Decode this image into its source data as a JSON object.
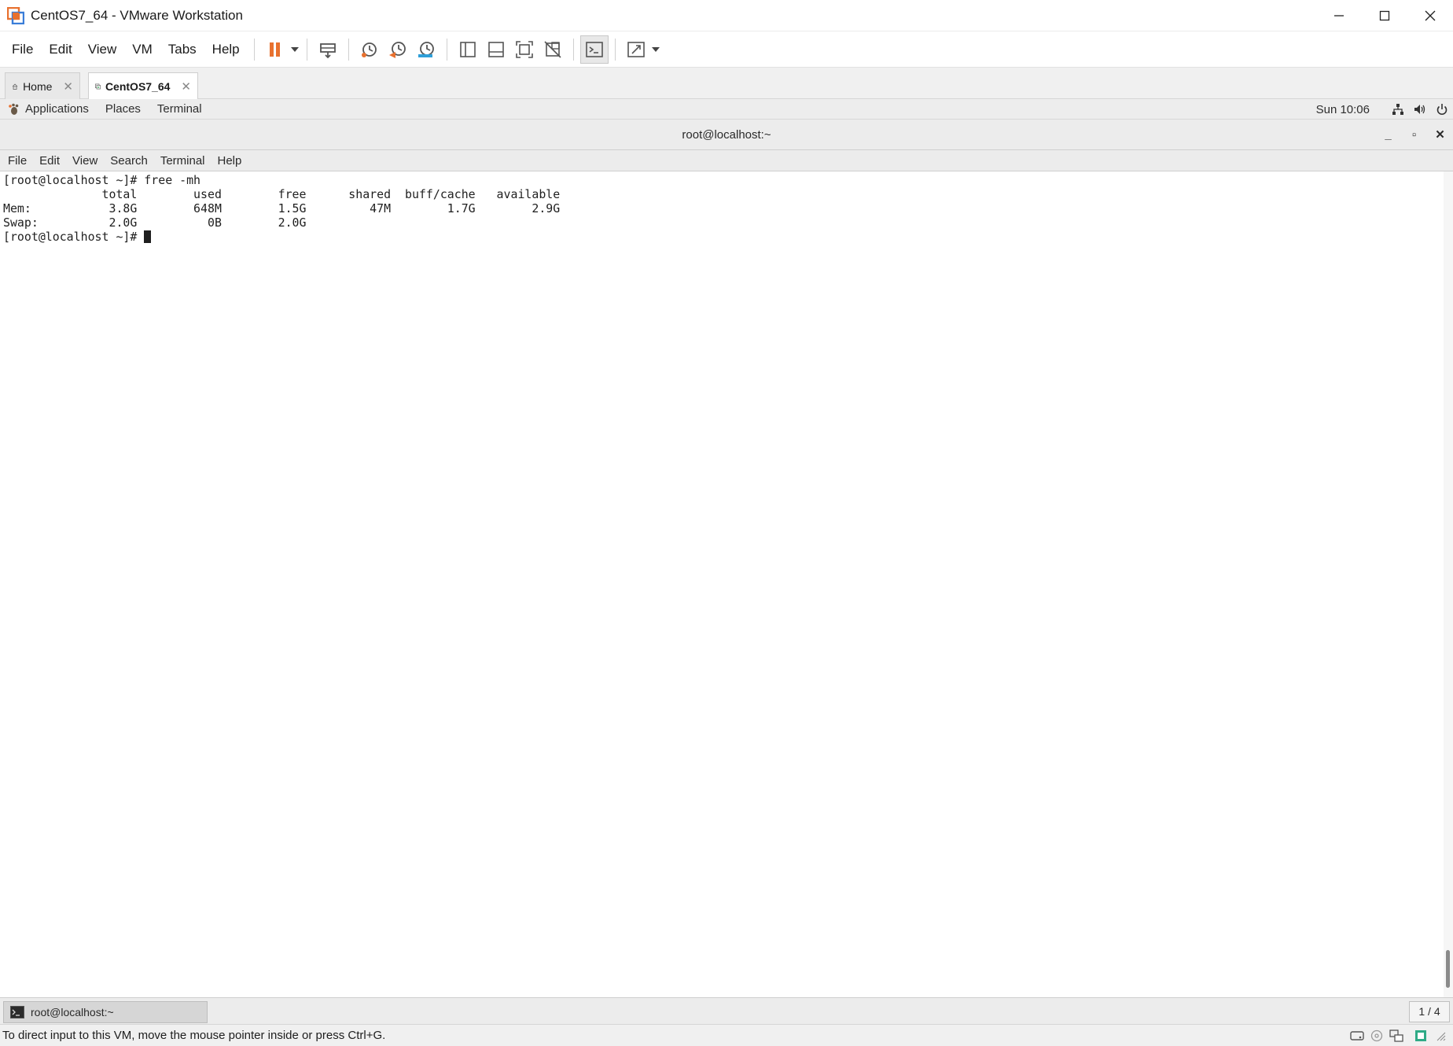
{
  "window": {
    "title": "CentOS7_64 - VMware Workstation",
    "controls": [
      "minimize-icon",
      "maximize-icon",
      "close-icon"
    ]
  },
  "menu": {
    "items": [
      "File",
      "Edit",
      "View",
      "VM",
      "Tabs",
      "Help"
    ]
  },
  "toolbar": {
    "icons": [
      "pause-icon",
      "send-ctrl-alt-del-icon",
      "snapshot-icon",
      "revert-snapshot-icon",
      "snapshot-manager-icon",
      "library-view-icon",
      "thumbnail-view-icon",
      "full-screen-icon",
      "unity-icon",
      "console-view-icon",
      "stretch-guest-icon"
    ],
    "accent": "#e8712f"
  },
  "tabs": [
    {
      "label": "Home",
      "active": false
    },
    {
      "label": "CentOS7_64",
      "active": true
    }
  ],
  "gnome_panel": {
    "applications": "Applications",
    "places": "Places",
    "terminal": "Terminal",
    "clock": "Sun 10:06",
    "tray_icons": [
      "network-icon",
      "volume-icon",
      "power-icon"
    ]
  },
  "terminal_window": {
    "title": "root@localhost:~",
    "menu": [
      "File",
      "Edit",
      "View",
      "Search",
      "Terminal",
      "Help"
    ],
    "lines": [
      "[root@localhost ~]# free -mh",
      "              total        used        free      shared  buff/cache   available",
      "Mem:           3.8G        648M        1.5G         47M        1.7G        2.9G",
      "Swap:          2.0G          0B        2.0G"
    ],
    "prompt": "[root@localhost ~]# "
  },
  "taskbar": {
    "task_label": "root@localhost:~",
    "workspace": "1 / 4"
  },
  "statusbar": {
    "message": "To direct input to this VM, move the mouse pointer inside or press Ctrl+G.",
    "icons": [
      "hard-disk-icon",
      "cd-dvd-icon",
      "network-adapter-icon",
      "message-icon"
    ]
  }
}
